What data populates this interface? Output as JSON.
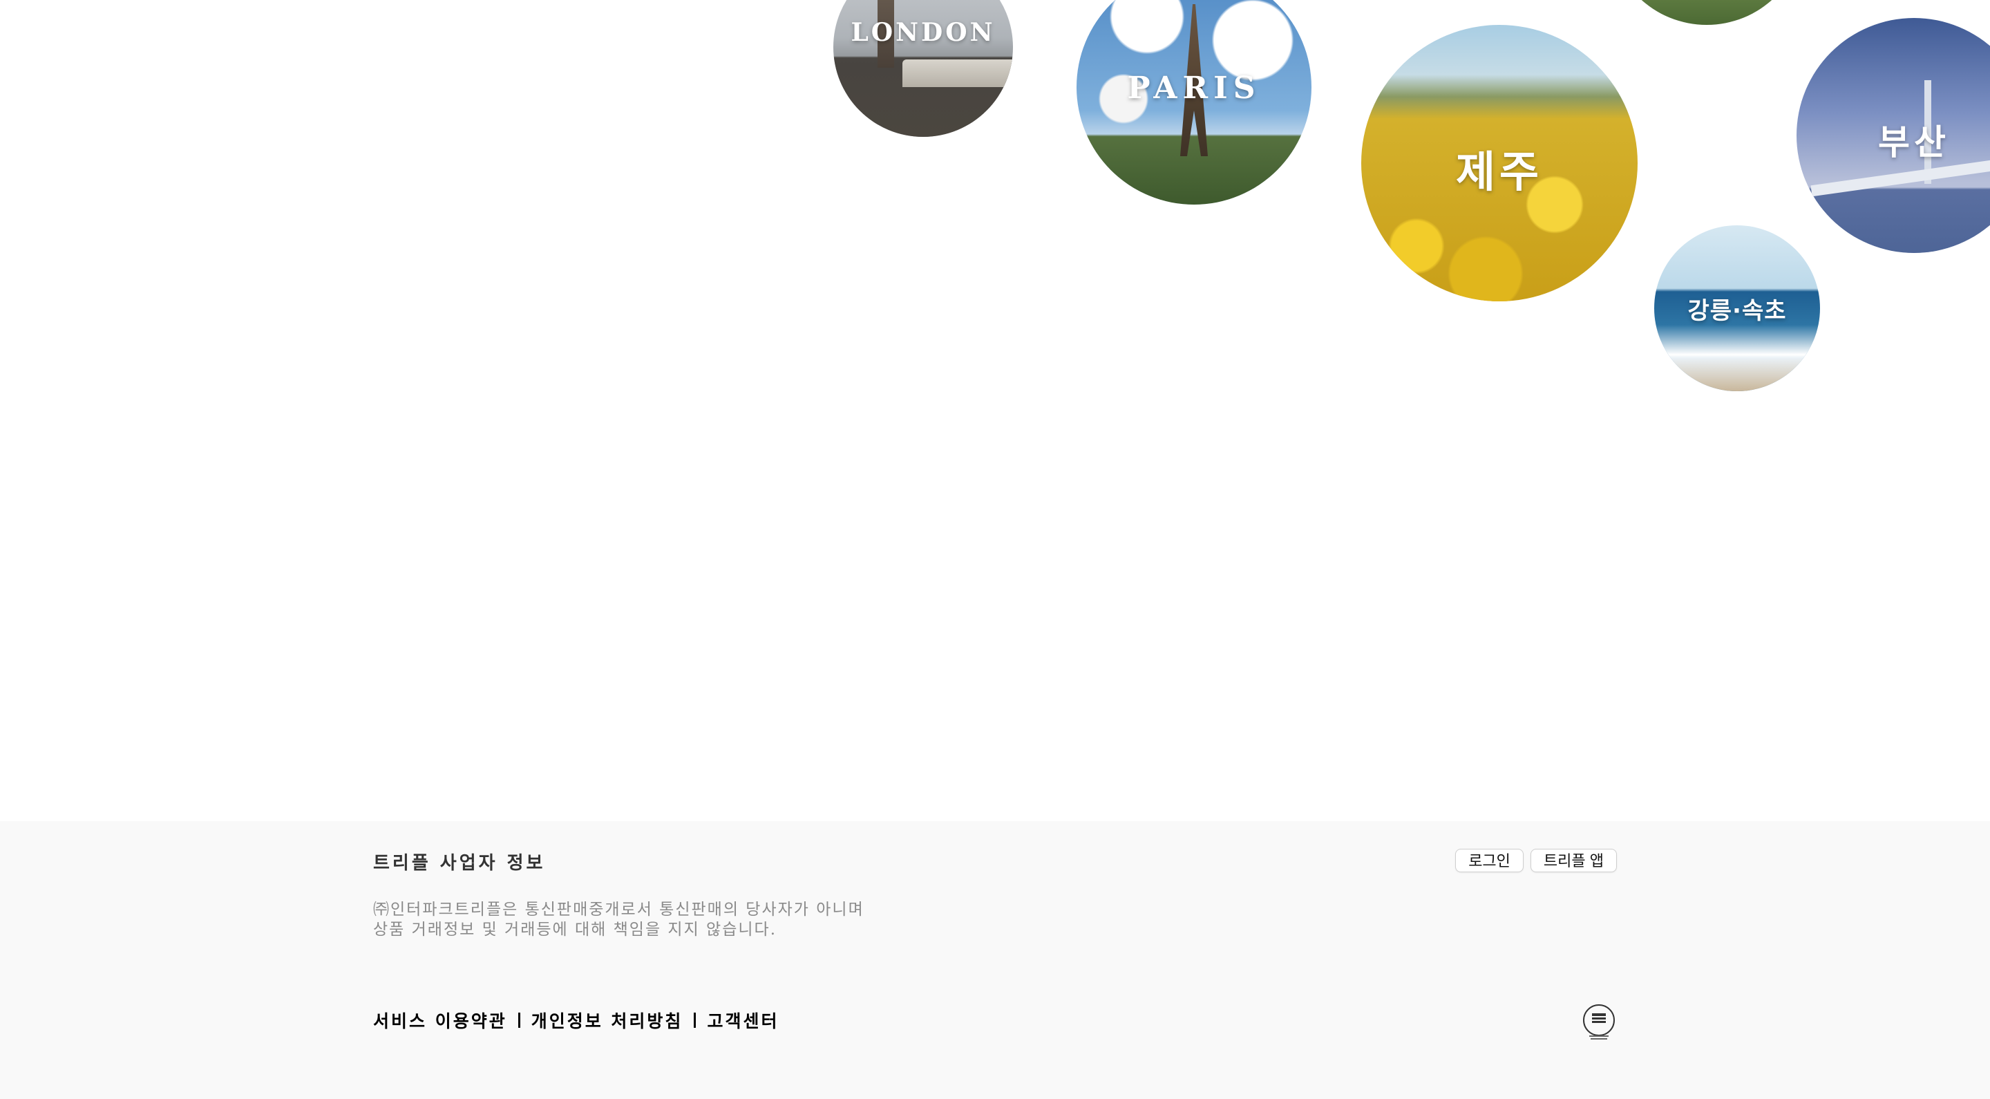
{
  "destinations": [
    {
      "id": "london",
      "label": "LONDON"
    },
    {
      "id": "paris",
      "label": "PARIS"
    },
    {
      "id": "jeju",
      "label": "제주"
    },
    {
      "id": "busan",
      "label": "부산"
    },
    {
      "id": "gangneung",
      "label": "강릉·속초"
    }
  ],
  "footer": {
    "title": "트리플 사업자 정보",
    "description_lines": [
      "㈜인터파크트리플은 통신판매중개로서 통신판매의 당사자가 아니며",
      "상품 거래정보 및 거래등에 대해 책임을 지지 않습니다."
    ],
    "links": [
      "서비스 이용약관",
      "개인정보 처리방침",
      "고객센터"
    ],
    "buttons": {
      "login": "로그인",
      "app": "트리플 앱"
    },
    "certification_icon": "dnv-certification-badge-icon"
  }
}
